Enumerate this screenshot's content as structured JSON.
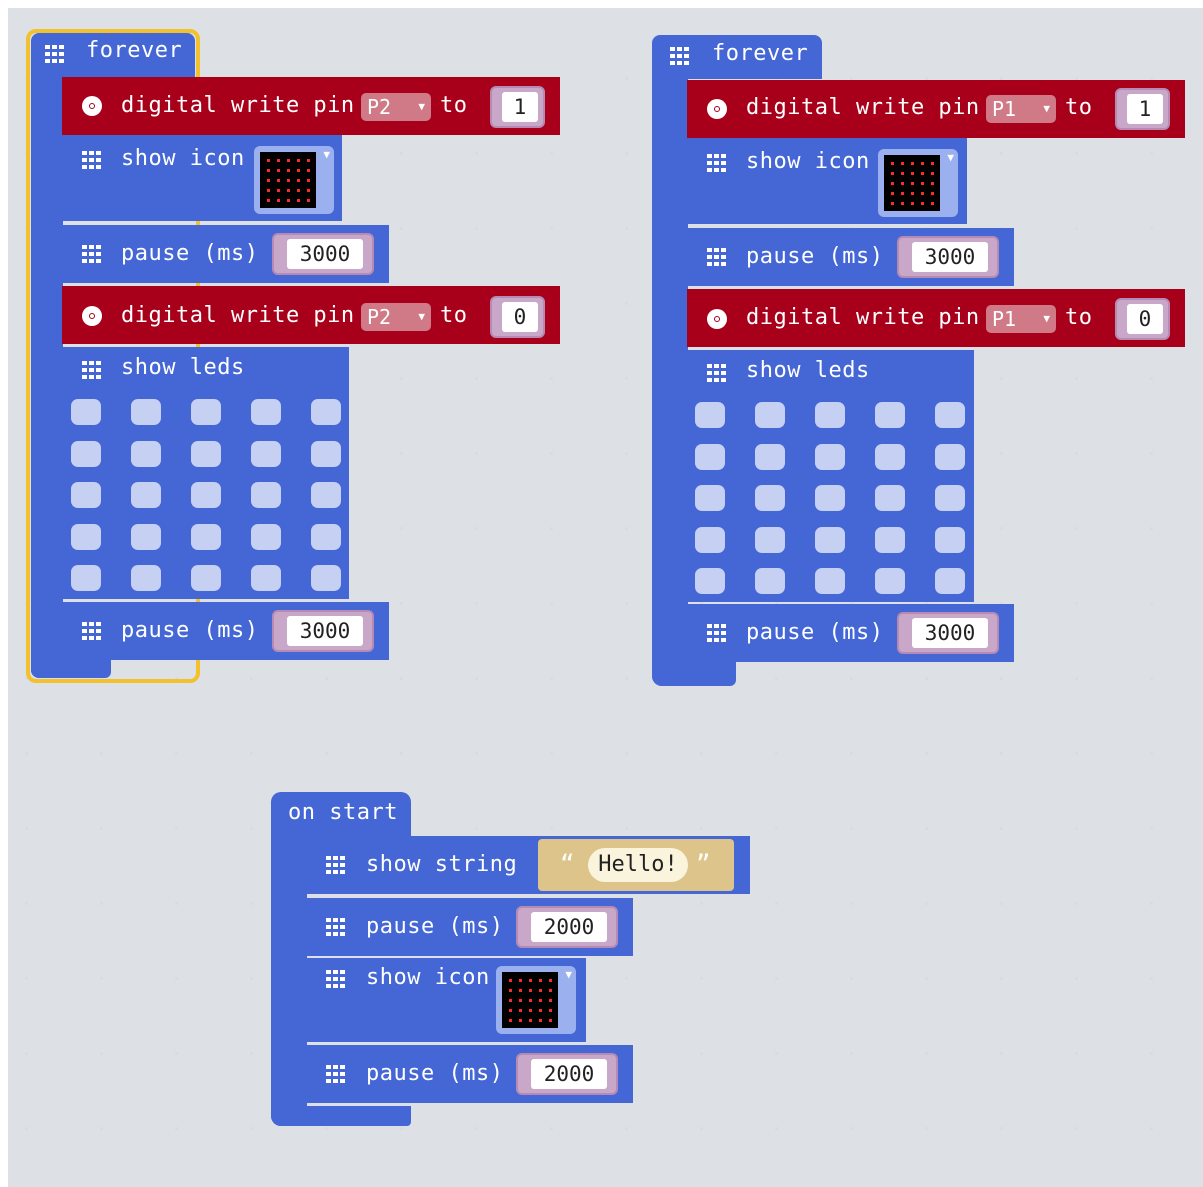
{
  "blocks": {
    "forever_left": {
      "hat_label": "forever",
      "write1": {
        "label": "digital write pin",
        "pin": "P2",
        "to": "to",
        "value": "1"
      },
      "show_icon": {
        "label": "show icon"
      },
      "pause1": {
        "label": "pause (ms)",
        "value": "3000"
      },
      "write2": {
        "label": "digital write pin",
        "pin": "P2",
        "to": "to",
        "value": "0"
      },
      "show_leds": {
        "label": "show leds"
      },
      "pause2": {
        "label": "pause (ms)",
        "value": "3000"
      }
    },
    "forever_right": {
      "hat_label": "forever",
      "write1": {
        "label": "digital write pin",
        "pin": "P1",
        "to": "to",
        "value": "1"
      },
      "show_icon": {
        "label": "show icon"
      },
      "pause1": {
        "label": "pause (ms)",
        "value": "3000"
      },
      "write2": {
        "label": "digital write pin",
        "pin": "P1",
        "to": "to",
        "value": "0"
      },
      "show_leds": {
        "label": "show leds"
      },
      "pause2": {
        "label": "pause (ms)",
        "value": "3000"
      }
    },
    "on_start": {
      "hat_label": "on start",
      "show_string": {
        "label": "show string",
        "open_quote": "“",
        "value": "Hello!",
        "close_quote": "”"
      },
      "pause1": {
        "label": "pause (ms)",
        "value": "2000"
      },
      "show_icon": {
        "label": "show icon"
      },
      "pause2": {
        "label": "pause (ms)",
        "value": "2000"
      }
    }
  },
  "colors": {
    "basic_blue": "#4567d6",
    "pins_red": "#a8001a",
    "selection_outline": "#f2c12e",
    "workspace_bg": "#ebeef1"
  },
  "icons": {
    "basic": "grid-icon",
    "pins": "pin-icon",
    "dropdown": "triangle-down-icon"
  }
}
